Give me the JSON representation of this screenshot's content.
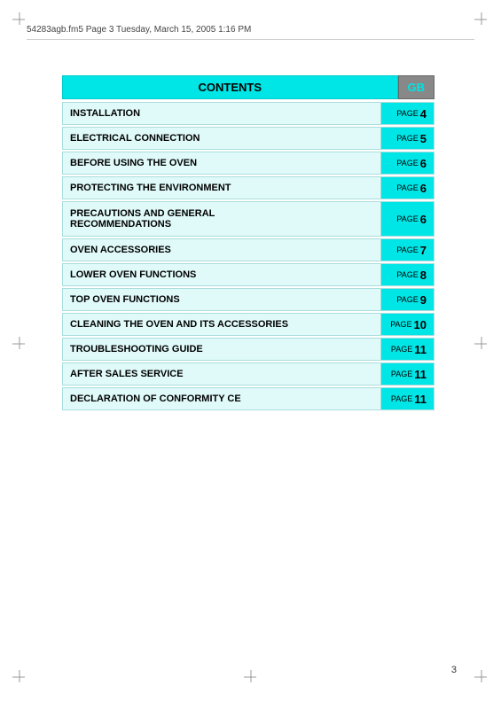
{
  "header": {
    "text": "54283agb.fm5  Page 3  Tuesday, March 15, 2005  1:16 PM"
  },
  "contents_title": "CONTENTS",
  "gb_label": "GB",
  "toc": [
    {
      "label": "INSTALLATION",
      "page_word": "PAGE",
      "page_num": "4"
    },
    {
      "label": "ELECTRICAL CONNECTION",
      "page_word": "PAGE",
      "page_num": "5"
    },
    {
      "label": "BEFORE USING THE OVEN",
      "page_word": "PAGE",
      "page_num": "6"
    },
    {
      "label": "PROTECTING THE ENVIRONMENT",
      "page_word": "PAGE",
      "page_num": "6"
    },
    {
      "label1": "PRECAUTIONS AND GENERAL",
      "label2": "RECOMMENDATIONS",
      "page_word": "PAGE",
      "page_num": "6",
      "double": true
    },
    {
      "label": "OVEN ACCESSORIES",
      "page_word": "PAGE",
      "page_num": "7"
    },
    {
      "label": "LOWER OVEN FUNCTIONS",
      "page_word": "PAGE",
      "page_num": "8"
    },
    {
      "label": "TOP OVEN FUNCTIONS",
      "page_word": "PAGE",
      "page_num": "9"
    },
    {
      "label": "CLEANING THE OVEN AND ITS ACCESSORIES",
      "page_word": "PAGE",
      "page_num": "10"
    },
    {
      "label": "TROUBLESHOOTING GUIDE",
      "page_word": "PAGE",
      "page_num": "11"
    },
    {
      "label": "AFTER SALES SERVICE",
      "page_word": "PAGE",
      "page_num": "11"
    },
    {
      "label": "DECLARATION OF CONFORMITY CE",
      "page_word": "PAGE",
      "page_num": "11"
    }
  ],
  "page_number": "3"
}
